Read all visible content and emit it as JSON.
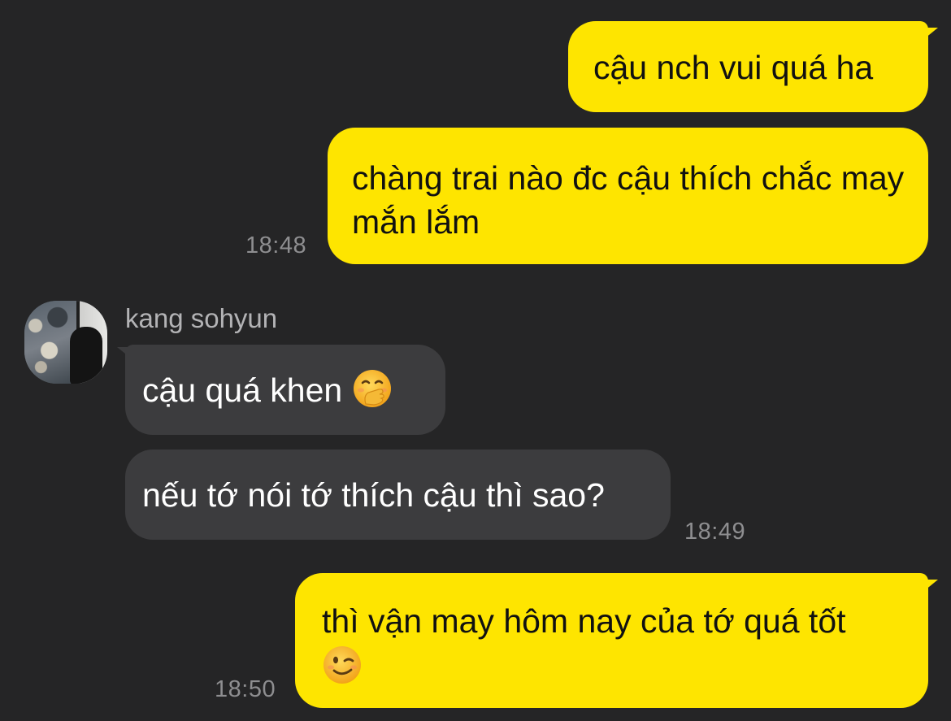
{
  "messages": [
    {
      "id": "m1",
      "from": "me",
      "text": "cậu nch vui quá ha"
    },
    {
      "id": "m2",
      "from": "me",
      "text": "chàng trai nào đc cậu thích chắc may mắn lắm",
      "time": "18:48"
    },
    {
      "id": "m3",
      "from": "kang sohyun",
      "text": "cậu quá khen",
      "emoji": "hand-over-mouth-emoji"
    },
    {
      "id": "m4",
      "from": "kang sohyun",
      "text": "nếu tớ nói tớ thích cậu thì sao?",
      "time": "18:49"
    },
    {
      "id": "m5",
      "from": "me",
      "text": "thì vận may hôm nay của tớ quá tốt",
      "emoji": "winking-face-emoji",
      "time": "18:50"
    }
  ],
  "sender": {
    "name": "kang sohyun",
    "avatar": "profile-photo"
  },
  "colors": {
    "background": "#252526",
    "outgoing_bubble": "#fee500",
    "incoming_bubble": "#3c3c3e",
    "timestamp": "#8e8e90"
  }
}
